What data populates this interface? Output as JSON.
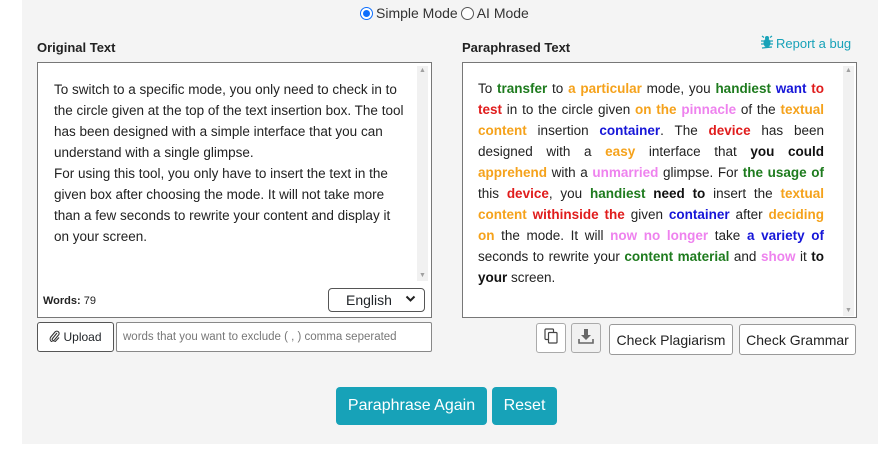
{
  "modes": {
    "simple_label": "Simple Mode",
    "ai_label": "AI Mode",
    "selected": "Simple Mode"
  },
  "original": {
    "heading": "Original Text",
    "paragraphs": [
      "To switch to a specific mode, you only need to check in to the circle given at the top of the text insertion box. The tool has been designed with a simple interface that you can understand with a single glimpse.",
      "For using this tool, you only have to insert the text in the given box after choosing the mode. It will not take more than a few seconds to rewrite your content and display it on your screen."
    ],
    "words_label": "Words:",
    "words_count": "79",
    "language": "English"
  },
  "paraphrased": {
    "heading": "Paraphrased Text",
    "report_label": "Report a bug",
    "segments": [
      {
        "t": "To ",
        "c": ""
      },
      {
        "t": "transfer",
        "c": "green"
      },
      {
        "t": " to ",
        "c": ""
      },
      {
        "t": "a particular",
        "c": "orange"
      },
      {
        "t": " mode, you ",
        "c": ""
      },
      {
        "t": "handiest",
        "c": "green"
      },
      {
        "t": " ",
        "c": ""
      },
      {
        "t": "want",
        "c": "blue"
      },
      {
        "t": " ",
        "c": ""
      },
      {
        "t": "to test",
        "c": "red"
      },
      {
        "t": " in to the circle given ",
        "c": ""
      },
      {
        "t": "on the",
        "c": "orange"
      },
      {
        "t": " ",
        "c": ""
      },
      {
        "t": "pinnacle",
        "c": "pink"
      },
      {
        "t": " of the ",
        "c": ""
      },
      {
        "t": "textual content",
        "c": "orange"
      },
      {
        "t": " insertion ",
        "c": ""
      },
      {
        "t": "container",
        "c": "blue"
      },
      {
        "t": ". The ",
        "c": ""
      },
      {
        "t": "device",
        "c": "red"
      },
      {
        "t": " has been designed with a ",
        "c": ""
      },
      {
        "t": "easy",
        "c": "orange"
      },
      {
        "t": " interface that ",
        "c": ""
      },
      {
        "t": "you could",
        "c": "black"
      },
      {
        "t": " ",
        "c": ""
      },
      {
        "t": "apprehend",
        "c": "orange"
      },
      {
        "t": " with a ",
        "c": ""
      },
      {
        "t": "unmarried",
        "c": "pink"
      },
      {
        "t": " glimpse. For ",
        "c": ""
      },
      {
        "t": "the usage of",
        "c": "green"
      },
      {
        "t": " this ",
        "c": ""
      },
      {
        "t": "device",
        "c": "red"
      },
      {
        "t": ", you ",
        "c": ""
      },
      {
        "t": "handiest",
        "c": "green"
      },
      {
        "t": " ",
        "c": ""
      },
      {
        "t": "need to",
        "c": "black"
      },
      {
        "t": " insert the ",
        "c": ""
      },
      {
        "t": "textual content",
        "c": "orange"
      },
      {
        "t": " ",
        "c": ""
      },
      {
        "t": "withinside the",
        "c": "red"
      },
      {
        "t": " given ",
        "c": ""
      },
      {
        "t": "container",
        "c": "blue"
      },
      {
        "t": " after ",
        "c": ""
      },
      {
        "t": "deciding on",
        "c": "orange"
      },
      {
        "t": " the mode. It will ",
        "c": ""
      },
      {
        "t": "now no longer",
        "c": "pink"
      },
      {
        "t": " take ",
        "c": ""
      },
      {
        "t": "a variety of",
        "c": "blue"
      },
      {
        "t": " seconds to rewrite your ",
        "c": ""
      },
      {
        "t": "content material",
        "c": "green"
      },
      {
        "t": " and ",
        "c": ""
      },
      {
        "t": "show",
        "c": "pink"
      },
      {
        "t": " it ",
        "c": ""
      },
      {
        "t": "to your",
        "c": "black"
      },
      {
        "t": " screen.",
        "c": ""
      }
    ]
  },
  "controls": {
    "upload_label": "Upload",
    "exclude_placeholder": "words that you want to exclude ( , ) comma seperated",
    "check_plagiarism_label": "Check Plagiarism",
    "check_grammar_label": "Check Grammar",
    "paraphrase_again_label": "Paraphrase Again",
    "reset_label": "Reset"
  },
  "colors": {
    "accent": "#17a2b8",
    "green": "#1e7b1e",
    "orange": "#f5a21b",
    "red": "#e01c1c",
    "blue": "#1616d8",
    "pink": "#ee82ee",
    "black": "#111111"
  },
  "icons": {
    "report": "bug-icon",
    "upload": "paperclip-icon",
    "copy": "copy-icon",
    "download": "download-icon"
  }
}
